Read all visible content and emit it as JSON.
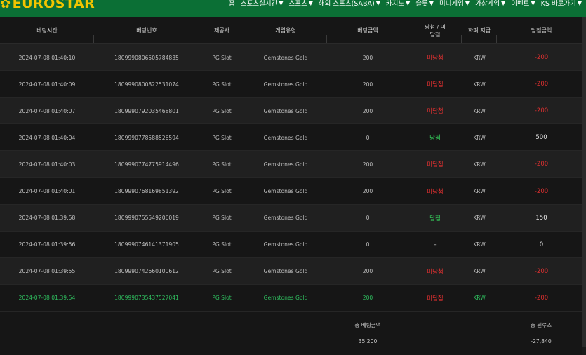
{
  "header": {
    "logo_text": "EUROSTAR",
    "nav": [
      {
        "label": "홈"
      },
      {
        "label": "스포츠실시간"
      },
      {
        "label": "스포츠"
      },
      {
        "label": "해외 스포츠(SABA)"
      },
      {
        "label": "카지노"
      },
      {
        "label": "슬롯"
      },
      {
        "label": "미니게임"
      },
      {
        "label": "가상게임"
      },
      {
        "label": "이벤트"
      },
      {
        "label": "KS 바로가기"
      }
    ]
  },
  "table": {
    "columns": [
      "베팅시간",
      "베팅번호",
      "제공사",
      "게임유형",
      "베팅금액",
      "당첨 / 미당첨",
      "화폐 지급",
      "당첨금액"
    ],
    "rows": [
      {
        "time": "2024-07-08 01:40:10",
        "id": "1809990806505784835",
        "provider": "PG Slot",
        "game": "Gemstones Gold",
        "bet": "200",
        "status": "미당첨",
        "currency": "KRW",
        "win": "-200"
      },
      {
        "time": "2024-07-08 01:40:09",
        "id": "1809990800822531074",
        "provider": "PG Slot",
        "game": "Gemstones Gold",
        "bet": "200",
        "status": "미당첨",
        "currency": "KRW",
        "win": "-200"
      },
      {
        "time": "2024-07-08 01:40:07",
        "id": "1809990792035468801",
        "provider": "PG Slot",
        "game": "Gemstones Gold",
        "bet": "200",
        "status": "미당첨",
        "currency": "KRW",
        "win": "-200"
      },
      {
        "time": "2024-07-08 01:40:04",
        "id": "1809990778588526594",
        "provider": "PG Slot",
        "game": "Gemstones Gold",
        "bet": "0",
        "status": "당첨",
        "currency": "KRW",
        "win": "500"
      },
      {
        "time": "2024-07-08 01:40:03",
        "id": "1809990774775914496",
        "provider": "PG Slot",
        "game": "Gemstones Gold",
        "bet": "200",
        "status": "미당첨",
        "currency": "KRW",
        "win": "-200"
      },
      {
        "time": "2024-07-08 01:40:01",
        "id": "1809990768169851392",
        "provider": "PG Slot",
        "game": "Gemstones Gold",
        "bet": "200",
        "status": "미당첨",
        "currency": "KRW",
        "win": "-200"
      },
      {
        "time": "2024-07-08 01:39:58",
        "id": "1809990755549206019",
        "provider": "PG Slot",
        "game": "Gemstones Gold",
        "bet": "0",
        "status": "당첨",
        "currency": "KRW",
        "win": "150"
      },
      {
        "time": "2024-07-08 01:39:56",
        "id": "1809990746141371905",
        "provider": "PG Slot",
        "game": "Gemstones Gold",
        "bet": "0",
        "status": "-",
        "currency": "KRW",
        "win": "0"
      },
      {
        "time": "2024-07-08 01:39:55",
        "id": "1809990742660100612",
        "provider": "PG Slot",
        "game": "Gemstones Gold",
        "bet": "200",
        "status": "미당첨",
        "currency": "KRW",
        "win": "-200"
      },
      {
        "time": "2024-07-08 01:39:54",
        "id": "1809990735437527041",
        "provider": "PG Slot",
        "game": "Gemstones Gold",
        "bet": "200",
        "status": "미당첨",
        "currency": "KRW",
        "win": "-200"
      }
    ]
  },
  "summary": {
    "total_bet_label": "총 베팅금액",
    "total_bet_value": "35,200",
    "total_winloss_label": "총 윈루즈",
    "total_winloss_value": "-27,840"
  },
  "colors": {
    "brand": "#0b6f35",
    "logo": "#f2c400",
    "lose": "#e03030",
    "win": "#35d05c",
    "highlight_row": "#2fbf5f"
  }
}
